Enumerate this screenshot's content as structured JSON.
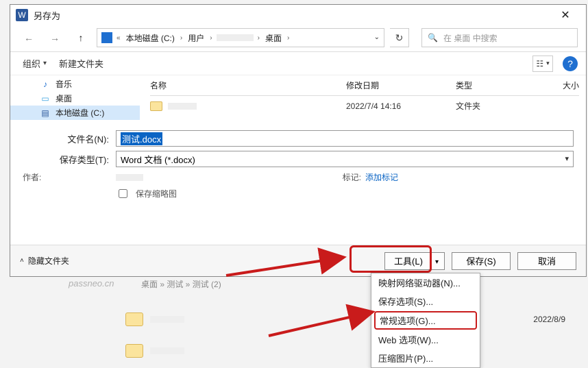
{
  "title": "另存为",
  "nav": {
    "disk": "本地磁盘 (C:)",
    "user": "用户",
    "desktop": "桌面",
    "search_placeholder": "在 桌面 中搜索"
  },
  "toolbar": {
    "organize": "组织",
    "newfolder": "新建文件夹"
  },
  "tree": {
    "music": "音乐",
    "desktop": "桌面",
    "disk": "本地磁盘 (C:)"
  },
  "columns": {
    "name": "名称",
    "date": "修改日期",
    "type": "类型",
    "size": "大小"
  },
  "folder_row": {
    "date": "2022/7/4 14:16",
    "type": "文件夹"
  },
  "filename_label": "文件名(N):",
  "filename_value": "测试.docx",
  "savetype_label": "保存类型(T):",
  "savetype_value": "Word 文档 (*.docx)",
  "author_label": "作者:",
  "tag_label": "标记:",
  "tag_link": "添加标记",
  "thumb": "保存缩略图",
  "hide_folders": "隐藏文件夹",
  "tools_btn": "工具(L)",
  "save_btn": "保存(S)",
  "cancel_btn": "取消",
  "tools_menu": {
    "map_drive": "映射网络驱动器(N)...",
    "save_opts": "保存选项(S)...",
    "general_opts": "常规选项(G)...",
    "web_opts": "Web 选项(W)...",
    "compress": "压缩图片(P)..."
  },
  "bg_watermark": "passneo.cn",
  "bg_crumb": "桌面 » 测试 » 测试 (2)",
  "bg_date1": "2022/8/9"
}
